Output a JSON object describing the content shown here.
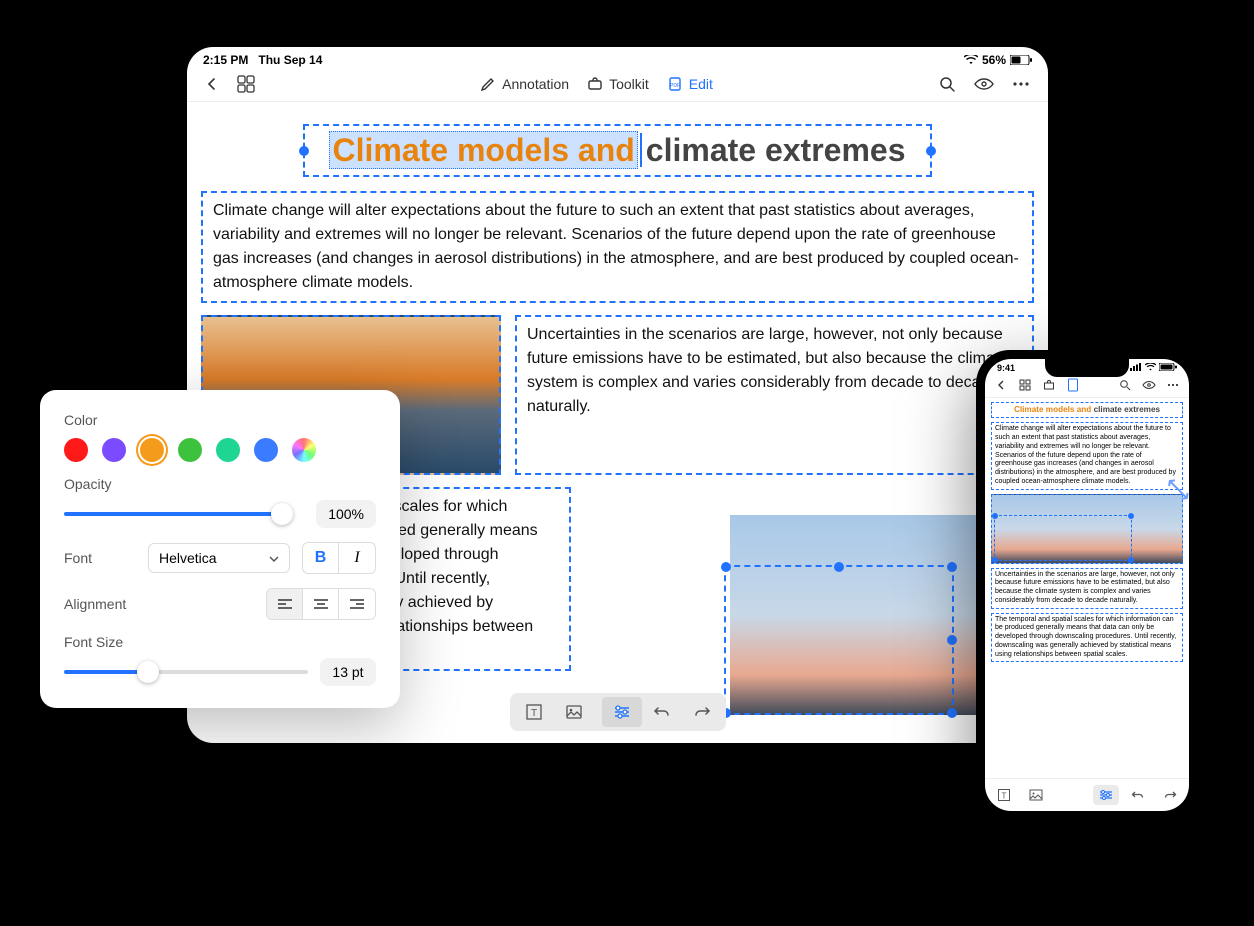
{
  "ipad": {
    "status": {
      "time": "2:15 PM",
      "date": "Thu Sep 14",
      "battery": "56%"
    },
    "toolbar": {
      "annotation": "Annotation",
      "toolkit": "Toolkit",
      "edit": "Edit"
    },
    "title": {
      "highlighted": "Climate models and",
      "rest": "climate extremes"
    },
    "para1": "Climate change will alter expectations about the future to such an extent that past statistics about averages, variability and extremes will no longer be relevant. Scenarios of the future depend upon the rate of greenhouse gas increases (and changes in aerosol distributions) in the atmosphere, and are best produced by coupled ocean-atmosphere climate models.",
    "para2": "Uncertainties in the scenarios are large, however, not only because future emissions have to be estimated, but also because the climate system is complex and varies considerably from decade to decade naturally.",
    "para3": "The temporal and spatial scales for which information can be produced generally means that data can only be developed through downscaling procedures. Until recently, downscaling was generally achieved by statistical means using relationships between spatial scales."
  },
  "panel": {
    "color_label": "Color",
    "opacity_label": "Opacity",
    "opacity_value": "100%",
    "font_label": "Font",
    "font_value": "Helvetica",
    "alignment_label": "Alignment",
    "fontsize_label": "Font Size",
    "fontsize_value": "13 pt",
    "colors": [
      "#ff1a1a",
      "#7b4bff",
      "#f59b1b",
      "#3cc23c",
      "#1ed692",
      "#3a7bff"
    ]
  },
  "iphone": {
    "time": "9:41",
    "title": {
      "highlighted": "Climate models and",
      "rest": "climate extremes"
    },
    "para1": "Climate change will alter expectations about the future to such an extent that past statistics about averages, variability and extremes will no longer be relevant. Scenarios of the future depend upon the rate of greenhouse gas increases (and changes in aerosol distributions) in the atmosphere, and are best produced by coupled ocean-atmosphere climate models.",
    "para2": "Uncertainties in the scenarios are large, however, not only because future emissions have to be estimated, but also because the climate system is complex and varies considerably from decade to decade naturally.",
    "para3": "The temporal and spatial scales for which information can be produced generally means that data can only be developed through downscaling procedures. Until recently, downscaling was generally achieved by statistical means using relationships between spatial scales."
  }
}
